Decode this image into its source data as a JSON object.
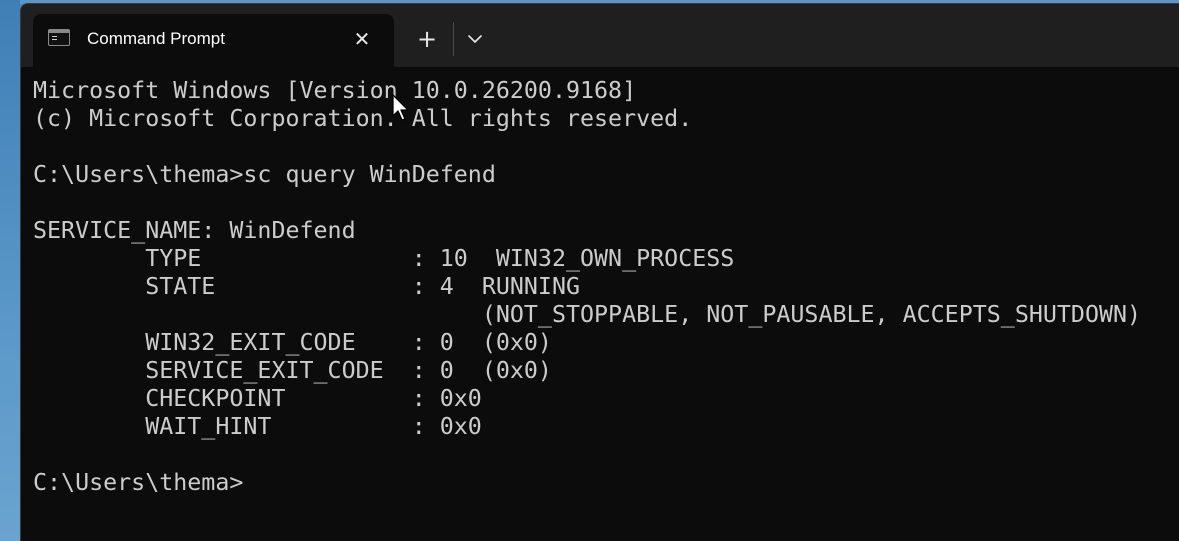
{
  "window": {
    "tab_title": "Command Prompt",
    "tab_close_glyph": "✕",
    "new_tab_glyph": "+",
    "icons": {
      "tab": "console-icon",
      "close": "close-icon",
      "new_tab": "plus-icon",
      "dropdown": "chevron-down-icon"
    }
  },
  "terminal": {
    "lines": [
      "Microsoft Windows [Version 10.0.26200.9168]",
      "(c) Microsoft Corporation. All rights reserved.",
      "",
      "C:\\Users\\thema>sc query WinDefend",
      "",
      "SERVICE_NAME: WinDefend",
      "        TYPE               : 10  WIN32_OWN_PROCESS",
      "        STATE              : 4  RUNNING",
      "                                (NOT_STOPPABLE, NOT_PAUSABLE, ACCEPTS_SHUTDOWN)",
      "        WIN32_EXIT_CODE    : 0  (0x0)",
      "        SERVICE_EXIT_CODE  : 0  (0x0)",
      "        CHECKPOINT         : 0x0",
      "        WAIT_HINT          : 0x0",
      "",
      "C:\\Users\\thema>"
    ]
  },
  "colors": {
    "terminal_bg": "#0c0c0c",
    "terminal_fg": "#cccccc",
    "titlebar_bg": "#1f1f1f",
    "tab_text": "#ffffff"
  }
}
